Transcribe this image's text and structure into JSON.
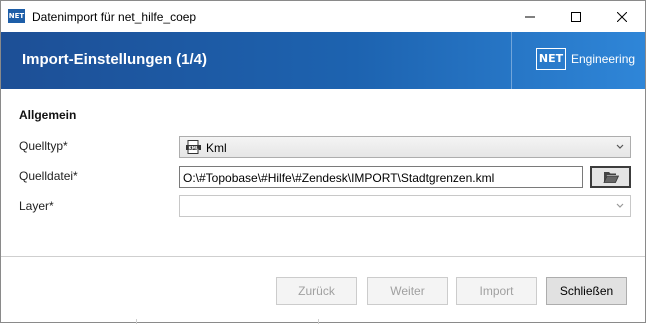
{
  "window": {
    "app_icon_text": "NET",
    "title": "Datenimport für net_hilfe_coep"
  },
  "header": {
    "title": "Import-Einstellungen (1/4)",
    "brand_box": "NET",
    "brand_text": "Engineering"
  },
  "form": {
    "section_title": "Allgemein",
    "source_type": {
      "label": "Quelltyp*",
      "value": "Kml",
      "icon": "kml-file-icon"
    },
    "source_file": {
      "label": "Quelldatei*",
      "value": "O:\\#Topobase\\#Hilfe\\#Zendesk\\IMPORT\\Stadtgrenzen.kml",
      "button_icon": "folder-open-icon"
    },
    "layer": {
      "label": "Layer*",
      "value": ""
    }
  },
  "footer": {
    "back_label": "Zurück",
    "next_label": "Weiter",
    "import_label": "Import",
    "close_label": "Schließen"
  },
  "colors": {
    "header_start": "#1d4f96",
    "header_end": "#2f86d8",
    "app_icon": "#1d5ea8"
  }
}
